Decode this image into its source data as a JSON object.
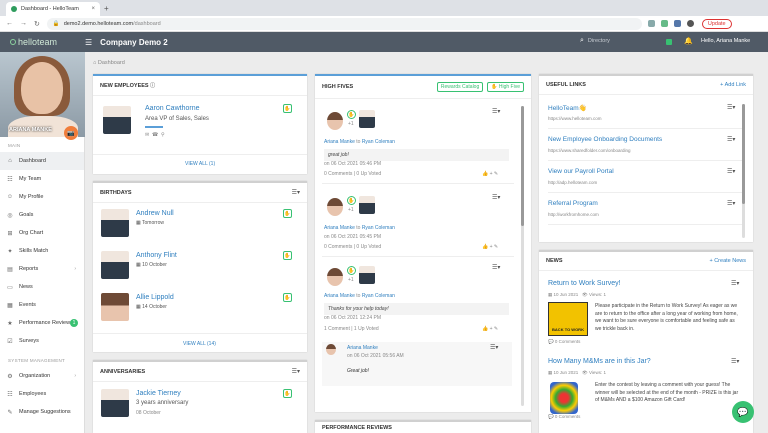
{
  "browser": {
    "tab_title": "Dashboard - HelloTeam",
    "url_host": "demo2.demo.helloteam.com",
    "url_path": "/dashboard",
    "update_label": "Update"
  },
  "header": {
    "logo": "helloteam",
    "company": "Company Demo 2",
    "search_placeholder": "Directory",
    "greeting": "Hello, Ariana Manke"
  },
  "sidebar": {
    "profile_name": "ARIANA MANKE",
    "main_label": "MAIN",
    "items": [
      {
        "label": "Dashboard"
      },
      {
        "label": "My Team"
      },
      {
        "label": "My Profile"
      },
      {
        "label": "Goals"
      },
      {
        "label": "Org Chart"
      },
      {
        "label": "Skills Match"
      },
      {
        "label": "Reports"
      },
      {
        "label": "News"
      },
      {
        "label": "Events"
      },
      {
        "label": "Performance Reviews",
        "badge": "1"
      },
      {
        "label": "Surveys"
      }
    ],
    "system_label": "SYSTEM MANAGEMENT",
    "system_items": [
      {
        "label": "Organization"
      },
      {
        "label": "Employees"
      },
      {
        "label": "Manage Suggestions"
      }
    ]
  },
  "breadcrumb": "Dashboard",
  "new_employees": {
    "title": "NEW EMPLOYEES",
    "name": "Aaron Cawthorne",
    "role": "Area VP of Sales, Sales",
    "view_all": "VIEW ALL (1)"
  },
  "birthdays": {
    "title": "BIRTHDAYS",
    "people": [
      {
        "name": "Andrew Null",
        "date": "Tomorrow"
      },
      {
        "name": "Anthony Flint",
        "date": "10 October"
      },
      {
        "name": "Allie Lippold",
        "date": "14 October"
      }
    ],
    "view_all": "VIEW ALL (14)"
  },
  "anniversaries": {
    "title": "ANNIVERSARIES",
    "name": "Jackie Tierney",
    "detail": "3 years anniversary",
    "date": "08 October"
  },
  "high_fives": {
    "title": "HIGH FIVES",
    "rewards_label": "Rewards Catalog",
    "highfive_label": "High Five",
    "posts": [
      {
        "from": "Ariana Manke",
        "to": "Ryan Coleman",
        "message": "great job!",
        "date": "on 06 Oct 2021 05:46 PM",
        "stats": "0 Comments | 0 Up Voted"
      },
      {
        "from": "Ariana Manke",
        "to": "Ryan Coleman",
        "message": "",
        "date": "on 06 Oct 2021 05:45 PM",
        "stats": "0 Comments | 0 Up Voted"
      },
      {
        "from": "Ariana Manke",
        "to": "Ryan Coleman",
        "message": "Thanks for your help today!",
        "date": "on 06 Oct 2021 12:24 PM",
        "stats": "1 Comment | 1 Up Voted"
      }
    ],
    "reply": {
      "name": "Ariana Manke",
      "date": "on 06 Oct 2021 05:56 AM",
      "message": "Great job!"
    },
    "plus_one": "+1",
    "with": "to"
  },
  "performance_reviews": {
    "title": "PERFORMANCE REVIEWS"
  },
  "useful_links": {
    "title": "USEFUL LINKS",
    "add_label": "+ Add Link",
    "links": [
      {
        "title": "HelloTeam👋",
        "url": "https://www.helloteam.com"
      },
      {
        "title": "New Employee Onboarding Documents",
        "url": "https://www.sharedfolder.com/onboarding"
      },
      {
        "title": "View our Payroll Portal",
        "url": "http://adp.helloteam.com"
      },
      {
        "title": "Referral Program",
        "url": "http://workfromhome.com"
      }
    ]
  },
  "news": {
    "title": "NEWS",
    "create_label": "+ Create News",
    "items": [
      {
        "title": "Return to Work Survey!",
        "date": "10 Jun 2021",
        "views": "Views: 1",
        "body": "Please participate in the Return to Work Survey! As eager as we are to return to the office after a long year of working from home, we want to be sure everyone is comfortable and feeling safe as we trickle back in.",
        "comments": "0 Comments",
        "image_caption": "BACK TO WORK"
      },
      {
        "title": "How Many M&Ms are in this Jar?",
        "date": "10 Jun 2021",
        "views": "Views: 1",
        "body": "Enter the contest by leaving a comment with your guess! The winner will be selected at the end of the month - PRIZE is this jar of M&Ms AND a $100 Amazon Gift Card!",
        "comments": "0 Comments"
      }
    ]
  },
  "colors": {
    "accent": "#38c172",
    "link": "#2f7fbf",
    "header": "#505a66",
    "card_top": "#5b9fd8"
  }
}
